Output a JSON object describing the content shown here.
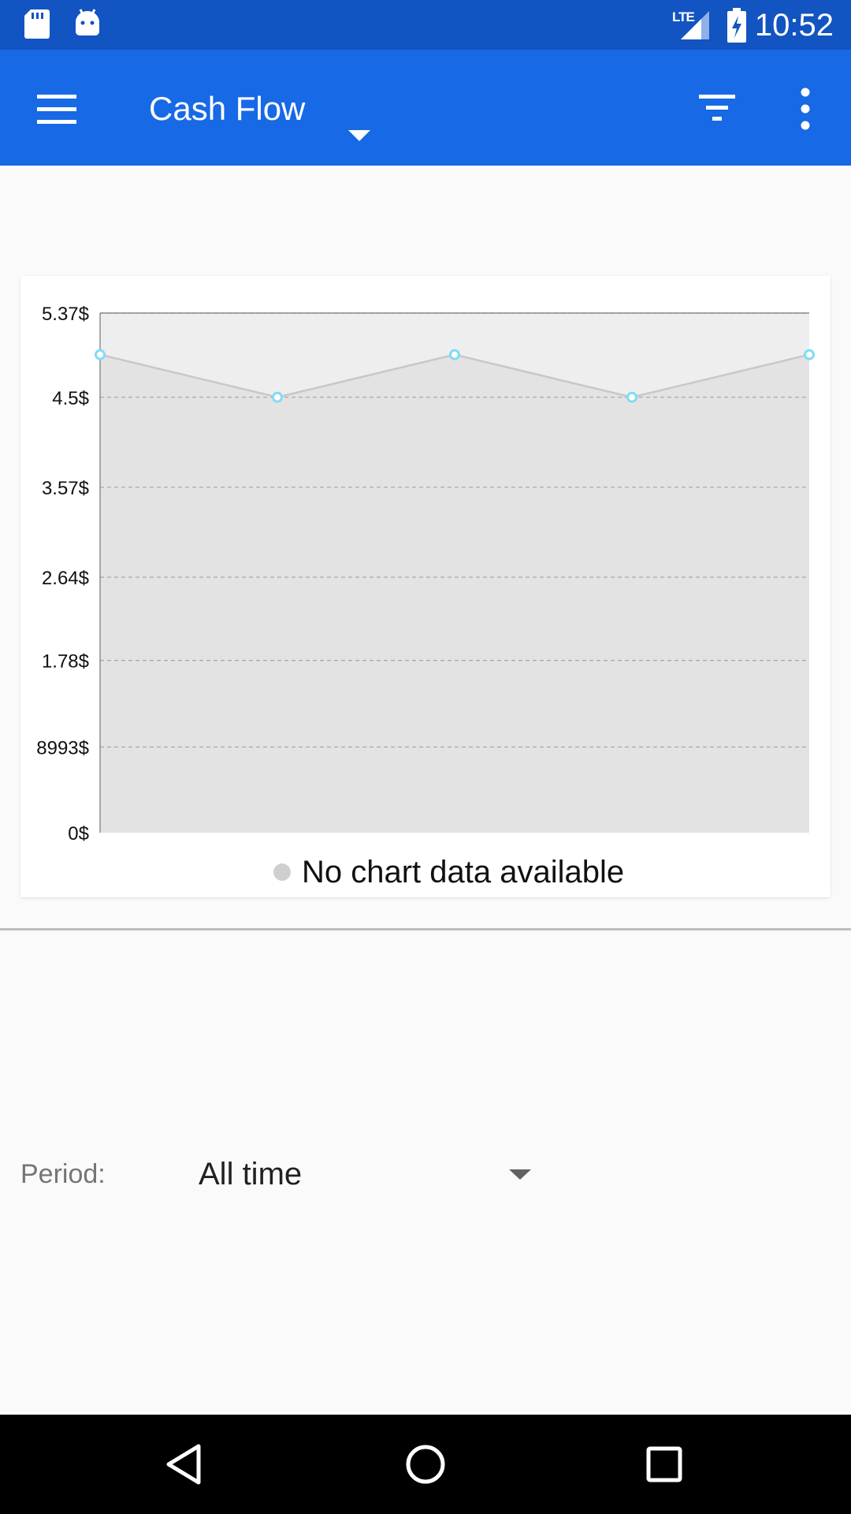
{
  "status_bar": {
    "time": "10:52",
    "network": "LTE",
    "icons": [
      "sd-card-icon",
      "android-debug-icon",
      "signal-icon",
      "battery-charging-icon"
    ]
  },
  "app_bar": {
    "title": "Cash Flow",
    "icons": [
      "menu-icon",
      "dropdown-caret-icon",
      "filter-icon",
      "more-vert-icon"
    ],
    "color": "#1769e6",
    "status_color": "#1254c1"
  },
  "chart": {
    "legend": "No chart data available",
    "y_tick_labels": [
      "5.37$",
      "4.5$",
      "3.57$",
      "2.64$",
      "1.78$",
      "8993$",
      "0$"
    ]
  },
  "chart_data": {
    "type": "area",
    "title": "",
    "xlabel": "",
    "ylabel": "",
    "x": [
      1,
      2,
      3,
      4,
      5
    ],
    "values": [
      4.94,
      4.5,
      4.94,
      4.5,
      4.94
    ],
    "ylim": [
      0,
      5.37
    ],
    "yticks": [
      0,
      0.885,
      1.78,
      2.64,
      3.57,
      4.5,
      5.37
    ],
    "ytick_labels": [
      "0$",
      "8993$",
      "1.78$",
      "2.64$",
      "3.57$",
      "4.5$",
      "5.37$"
    ],
    "grid": true,
    "legend_position": "bottom",
    "legend": [
      "No chart data available"
    ],
    "colors": {
      "line": "#c8c8c8",
      "fill": "#e3e3e3",
      "point": "#7fdcf7"
    }
  },
  "period": {
    "label": "Period:",
    "value": "All time"
  },
  "nav_bar": {
    "icons": [
      "back-icon",
      "home-icon",
      "recents-icon"
    ]
  }
}
